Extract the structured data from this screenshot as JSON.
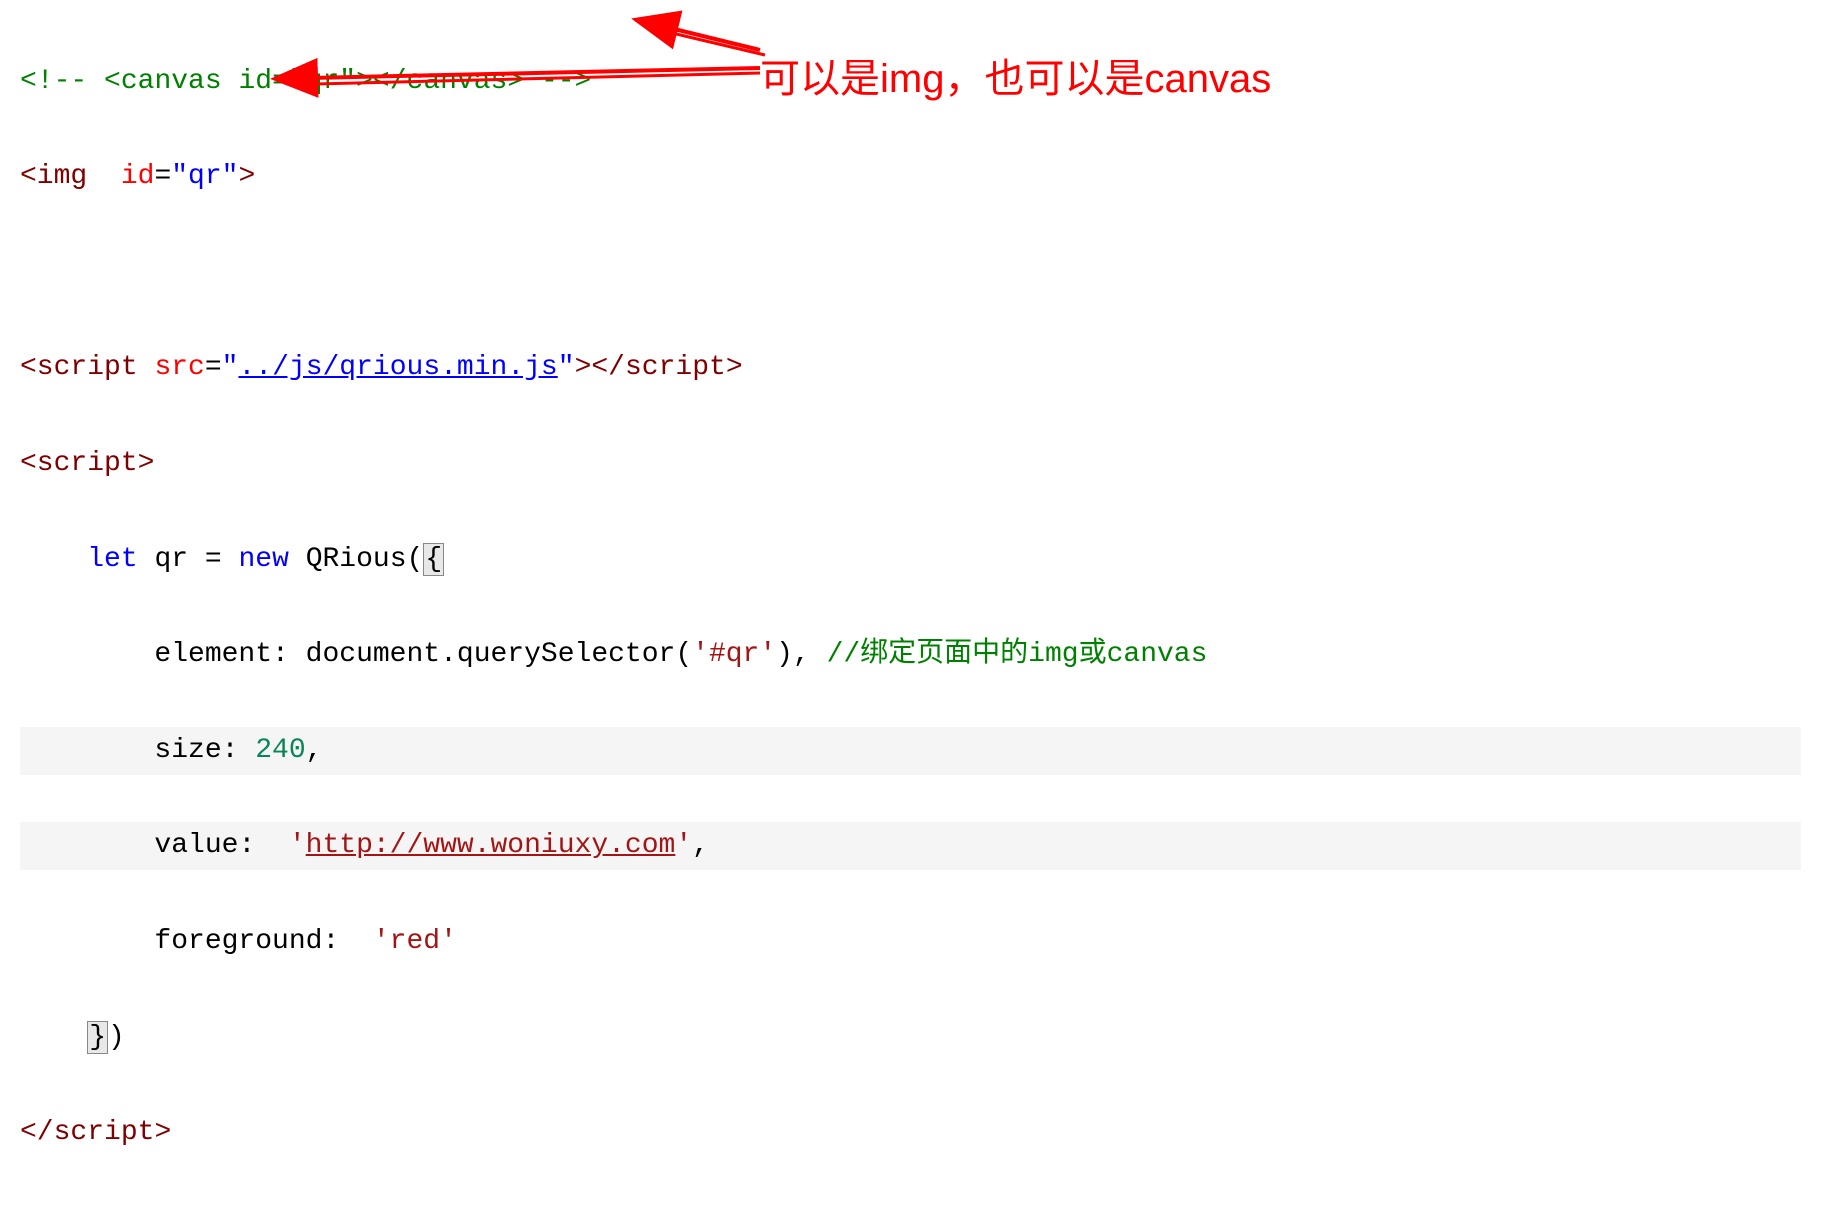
{
  "code": {
    "line1_comment_open": "<!--",
    "line1_tag_open": "<canvas",
    "line1_attr_name": "id",
    "line1_attr_eq": "=",
    "line1_attr_val": "\"qr\"",
    "line1_tag_close": "></canvas>",
    "line1_comment_close": "-->",
    "line2_tag": "<img",
    "line2_space": "  ",
    "line2_attr_name": "id",
    "line2_attr_eq": "=",
    "line2_attr_val": "\"qr\"",
    "line2_close": ">",
    "line4_tag": "<script",
    "line4_attr_name": "src",
    "line4_attr_eq": "=",
    "line4_q": "\"",
    "line4_link": "../js/qrious.min.js",
    "line4_close": "></",
    "line4_close2": "script",
    "line4_close3": ">",
    "line5_open": "<script>",
    "line6_let": "let",
    "line6_var": " qr ",
    "line6_eq": "= ",
    "line6_new": "new",
    "line6_class": " QRious",
    "line6_paren": "(",
    "line6_brace": "{",
    "line7_prop": "element",
    "line7_colon": ": ",
    "line7_doc": "document",
    "line7_dot": ".",
    "line7_func": "querySelector",
    "line7_args": "(",
    "line7_str": "'#qr'",
    "line7_close": "), ",
    "line7_comment": "//绑定页面中的img或canvas",
    "line8_prop": "size",
    "line8_colon": ": ",
    "line8_num": "240",
    "line8_comma": ",",
    "line9_prop": "value",
    "line9_colon": ":  ",
    "line9_str": "'http://www.woniuxy.com'",
    "line9_comma": ",",
    "line10_prop": "foreground",
    "line10_colon": ":  ",
    "line10_str": "'red'",
    "line11_brace": "}",
    "line11_paren": ")",
    "line12_close": "</",
    "line12_close2": "script",
    "line12_close3": ">"
  },
  "annotation": {
    "text": "可以是img，也可以是canvas"
  }
}
